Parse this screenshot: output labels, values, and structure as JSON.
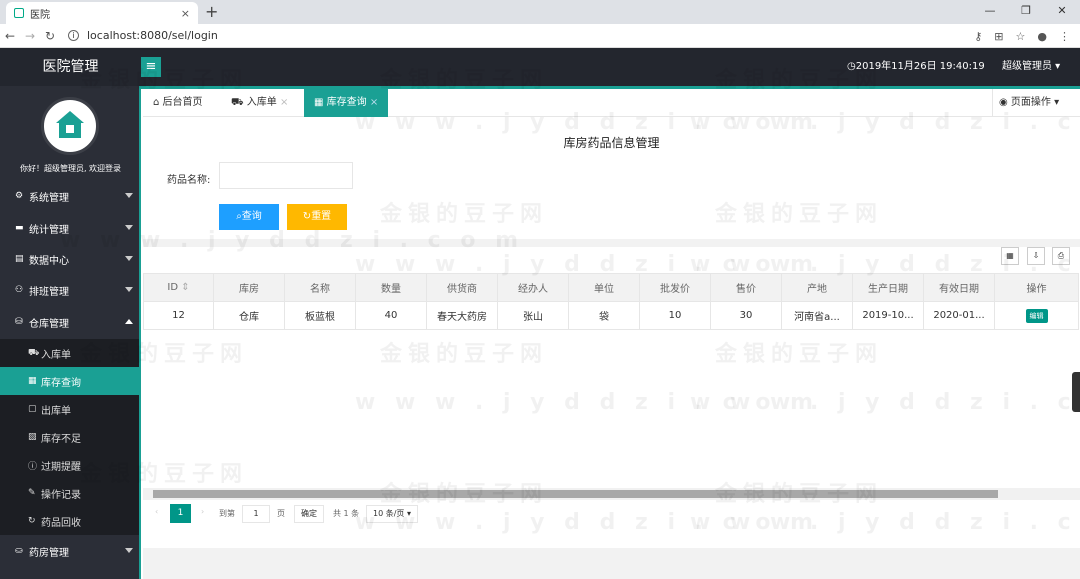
{
  "browser": {
    "tab_title": "医院",
    "close_glyph": "×",
    "new_tab": "+",
    "url": "localhost:8080/sel/login",
    "icons": [
      "back-icon",
      "forward-icon",
      "reload-icon",
      "key-icon",
      "translate-icon",
      "star-icon",
      "account-icon",
      "more-icon"
    ]
  },
  "header": {
    "app_title": "医院管理",
    "menu_glyph": "≡",
    "datetime": "◷2019年11月26日 19:40:19",
    "user": "超级管理员 ▾"
  },
  "sidebar": {
    "greeting": "你好！超级管理员, 欢迎登录",
    "groups": [
      {
        "label": "系统管理",
        "icon": "gear-icon"
      },
      {
        "label": "统计管理",
        "icon": "chat-icon"
      },
      {
        "label": "数据中心",
        "icon": "document-icon"
      },
      {
        "label": "排班管理",
        "icon": "user-icon"
      },
      {
        "label": "仓库管理",
        "icon": "warehouse-icon"
      },
      {
        "label": "药房管理",
        "icon": "pharmacy-icon"
      }
    ],
    "sub_items": [
      {
        "label": "入库单",
        "icon": "cart-icon"
      },
      {
        "label": "库存查询",
        "icon": "list-icon"
      },
      {
        "label": "出库单",
        "icon": "file-icon"
      },
      {
        "label": "库存不足",
        "icon": "doc-alert-icon"
      },
      {
        "label": "过期提醒",
        "icon": "info-icon"
      },
      {
        "label": "操作记录",
        "icon": "edit-icon"
      },
      {
        "label": "药品回收",
        "icon": "refresh-icon"
      }
    ]
  },
  "tabs": {
    "home": "后台首页",
    "inbound": "入库单",
    "inventory": "库存查询",
    "page_ops": "页面操作 ▾"
  },
  "main": {
    "title": "库房药品信息管理",
    "form_label": "药品名称:",
    "input_value": "",
    "query_btn": "查询",
    "reset_btn": "重置"
  },
  "table": {
    "headers": [
      "ID",
      "库房",
      "名称",
      "数量",
      "供货商",
      "经办人",
      "单位",
      "批发价",
      "售价",
      "产地",
      "生产日期",
      "有效日期",
      "操作"
    ],
    "rows": [
      [
        "12",
        "仓库",
        "板蓝根",
        "40",
        "春天大药房",
        "张山",
        "袋",
        "10",
        "30",
        "河南省a...",
        "2019-10...",
        "2020-01...",
        "编辑"
      ]
    ]
  },
  "pager": {
    "current": "1",
    "goto": "到第",
    "page_input": "1",
    "page": "页",
    "confirm": "确定",
    "total": "共 1 条",
    "per_page": "10 条/页 ▾"
  },
  "watermarks": [
    "金银的豆子网",
    "w w w . j y d d z i . c o m"
  ],
  "colors": {
    "accent": "#1aa094",
    "header": "#23262e",
    "sidebar": "#2b2e37",
    "query": "#1e9fff",
    "reset": "#ffb800"
  }
}
